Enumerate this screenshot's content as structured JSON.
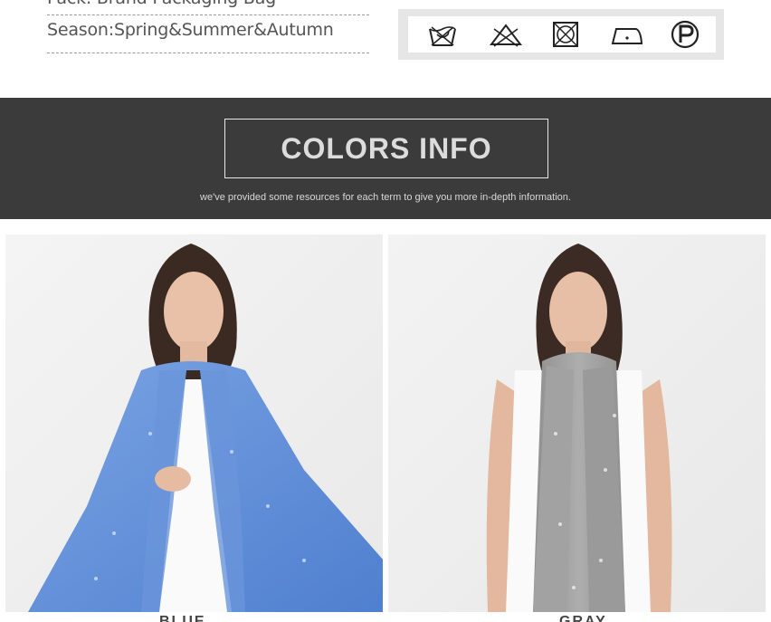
{
  "specs": {
    "pack_line": "Pack:  Brand Packaging Bag",
    "season_line": "Season:Spring&Summer&Autumn"
  },
  "care_icons": [
    {
      "name": "hand-wash-icon"
    },
    {
      "name": "do-not-bleach-icon"
    },
    {
      "name": "do-not-tumble-dry-icon"
    },
    {
      "name": "iron-low-heat-icon"
    },
    {
      "name": "dry-clean-p-icon"
    }
  ],
  "colors_info": {
    "title": "COLORS INFO",
    "subtitle": "we've provided some resources for each term to give you more in-depth information."
  },
  "products": [
    {
      "color_name": "BLUE",
      "scarf_color": "#5f8ed6"
    },
    {
      "color_name": "GRAY",
      "scarf_color": "#9c9c9c"
    }
  ],
  "colors": {
    "band_bg": "#3b3b3b",
    "text_muted": "#555555"
  }
}
